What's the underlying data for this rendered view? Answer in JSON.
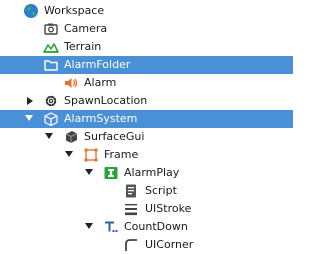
{
  "explorer": {
    "items": [
      {
        "label": "Workspace",
        "icon": "globe-icon"
      },
      {
        "label": "Camera",
        "icon": "camera-icon"
      },
      {
        "label": "Terrain",
        "icon": "terrain-icon"
      },
      {
        "label": "AlarmFolder",
        "icon": "folder-icon"
      },
      {
        "label": "Alarm",
        "icon": "sound-icon"
      },
      {
        "label": "SpawnLocation",
        "icon": "gear-icon"
      },
      {
        "label": "AlarmSystem",
        "icon": "part-icon"
      },
      {
        "label": "SurfaceGui",
        "icon": "surface-gui-icon"
      },
      {
        "label": "Frame",
        "icon": "frame-icon"
      },
      {
        "label": "AlarmPlay",
        "icon": "text-button-icon"
      },
      {
        "label": "Script",
        "icon": "script-icon"
      },
      {
        "label": "UIStroke",
        "icon": "ui-stroke-icon"
      },
      {
        "label": "CountDown",
        "icon": "text-label-icon"
      },
      {
        "label": "UICorner",
        "icon": "ui-corner-icon"
      }
    ]
  },
  "colors": {
    "selection": "#4a90d6",
    "text": "#1b1b1b",
    "accent_orange": "#e8742a",
    "accent_green": "#2aa33c"
  }
}
